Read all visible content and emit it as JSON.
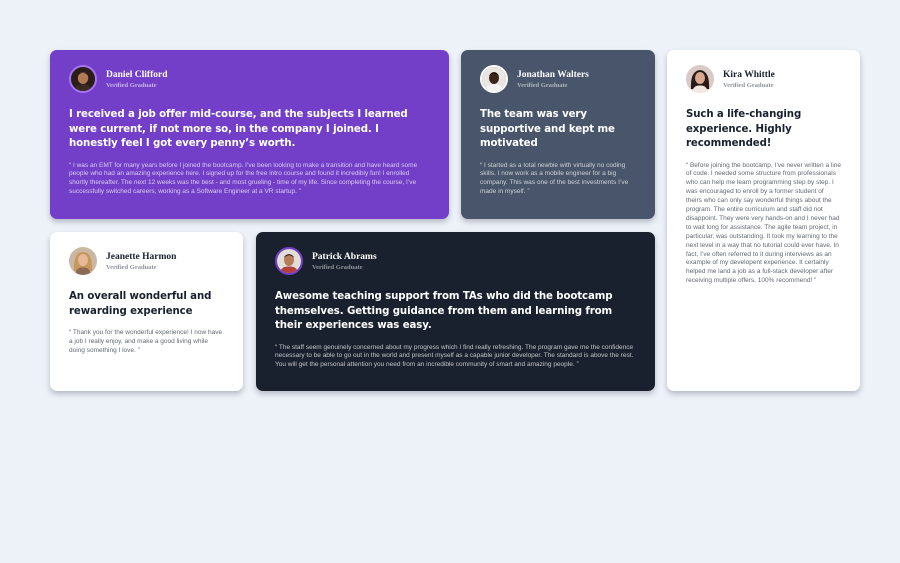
{
  "testimonials": [
    {
      "name": "Daniel Clifford",
      "role": "Verified Graduate",
      "avatar_icon": "avatar-daniel-icon",
      "headline": "I received a job offer mid-course, and the subjects I learned were current, if not more so, in the company I joined. I honestly feel I got every penny’s worth.",
      "quote": "“ I was an EMT for many years before I joined the bootcamp. I’ve been looking to make a transition and have heard some people who had an amazing experience here. I signed up for the free intro course and found it incredibly fun! I enrolled shortly thereafter. The next 12 weeks was the best - and most grueling - time of my life. Since completing the course, I’ve successfully switched careers, working as a Software Engineer at a VR startup. ”",
      "background": "#733fc8"
    },
    {
      "name": "Jonathan Walters",
      "role": "Verified Graduate",
      "avatar_icon": "avatar-jonathan-icon",
      "headline": "The team was very supportive and kept me motivated",
      "quote": "“ I started as a total newbie with virtually no coding skills. I now work as a mobile engineer for a big company. This was one of the best investments I’ve made in myself. ”",
      "background": "#48556a"
    },
    {
      "name": "Kira Whittle",
      "role": "Verified Graduate",
      "avatar_icon": "avatar-kira-icon",
      "headline": "Such a life-changing experience. Highly recommended!",
      "quote": "“ Before joining the bootcamp, I’ve never written a line of code. I needed some structure from professionals who can help me learn programming step by step. I was encouraged to enroll by a former student of theirs who can only say wonderful things about the program. The entire curriculum and staff did not disappoint. They were very hands-on and I never had to wait long for assistance. The agile team project, in particular, was outstanding. It took my learning to the next level in a way that no tutorial could ever have. In fact, I’ve often referred to it during interviews as an example of my developent experience. It certainly helped me land a job as a full-stack developer after receiving multiple offers. 100% recommend! ”",
      "background": "#ffffff"
    },
    {
      "name": "Jeanette Harmon",
      "role": "Verified Graduate",
      "avatar_icon": "avatar-jeanette-icon",
      "headline": "An overall wonderful and rewarding experience",
      "quote": "“ Thank you for the wonderful experience! I now have a job I really enjoy, and make a good living while doing something I love. ”",
      "background": "#ffffff"
    },
    {
      "name": "Patrick Abrams",
      "role": "Verified Graduate",
      "avatar_icon": "avatar-patrick-icon",
      "headline": "Awesome teaching support from TAs who did the bootcamp themselves. Getting guidance from them and learning from their experiences was easy.",
      "quote": "“ The staff seem genuinely concerned about my progress which I find really refreshing. The program gave me the confidence necessary to be able to go out in the world and present myself as a capable junior developer. The standard is above the rest. You will get the personal attention you need from an incredible community of smart and amazing people. ”",
      "background": "#19212e"
    }
  ]
}
